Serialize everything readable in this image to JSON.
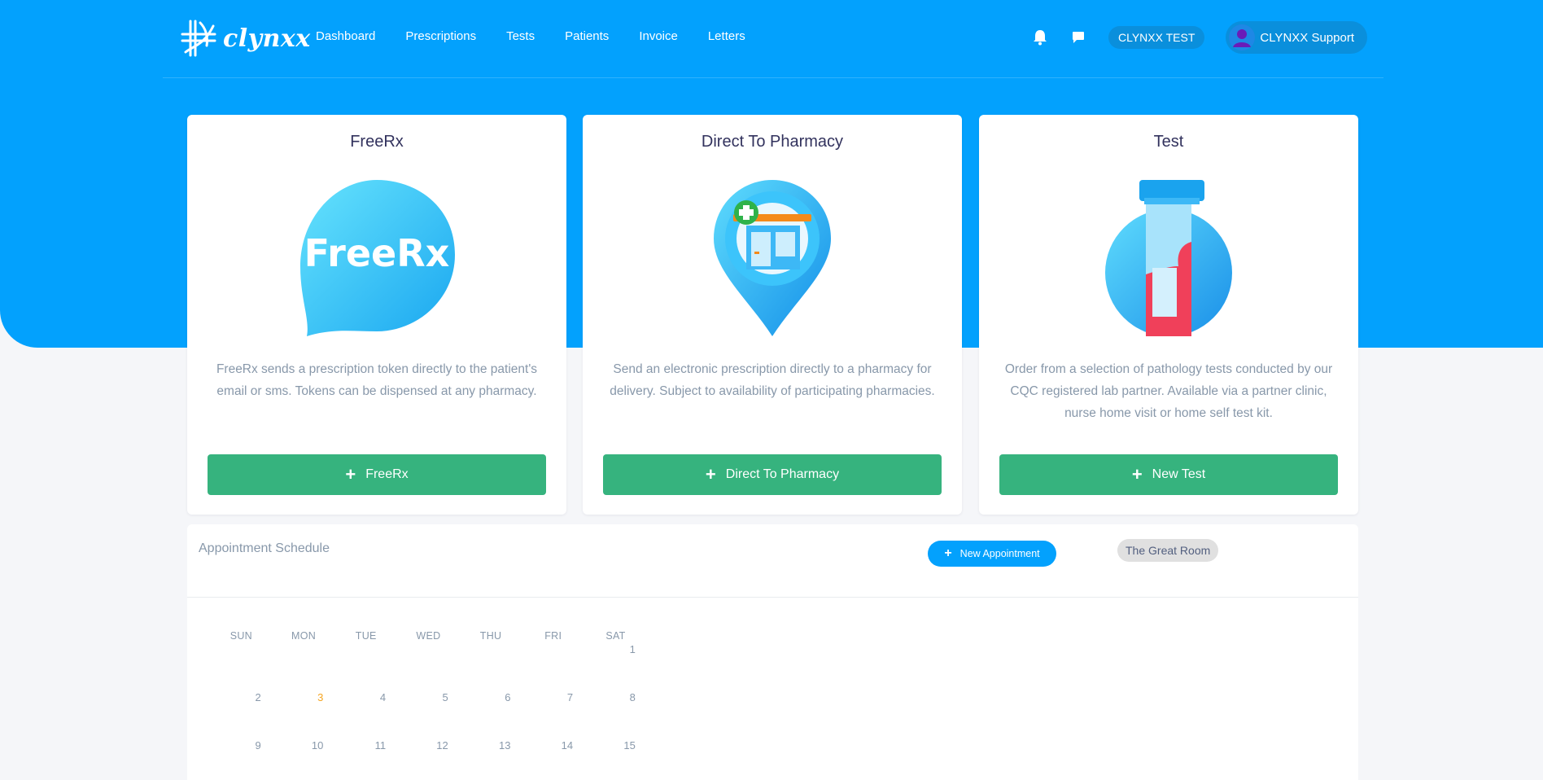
{
  "app": {
    "logo_text": "clynxx"
  },
  "nav": {
    "links": [
      "Dashboard",
      "Prescriptions",
      "Tests",
      "Patients",
      "Invoice",
      "Letters"
    ],
    "org": "CLYNXX TEST",
    "user": "CLYNXX Support"
  },
  "cards": [
    {
      "title": "FreeRx",
      "image_text": "FreeRx",
      "description": "FreeRx sends a prescription token directly to the patient's email or sms. Tokens can be dispensed at any pharmacy.",
      "button": "FreeRx"
    },
    {
      "title": "Direct To Pharmacy",
      "description": "Send an electronic prescription directly to a pharmacy for delivery. Subject to availability of participating pharmacies.",
      "button": "Direct To Pharmacy"
    },
    {
      "title": "Test",
      "description": "Order from a selection of pathology tests conducted by our CQC registered lab partner. Available via a partner clinic, nurse home visit or home self test kit.",
      "button": "New Test"
    }
  ],
  "schedule": {
    "title": "Appointment Schedule",
    "new_button": "New Appointment",
    "room": "The Great Room",
    "weekdays": [
      "SUN",
      "MON",
      "TUE",
      "WED",
      "THU",
      "FRI",
      "SAT"
    ],
    "weeks": [
      [
        "",
        "",
        "",
        "",
        "",
        "",
        "1"
      ],
      [
        "2",
        "3",
        "4",
        "5",
        "6",
        "7",
        "8"
      ],
      [
        "9",
        "10",
        "11",
        "12",
        "13",
        "14",
        "15"
      ]
    ],
    "today": "3"
  },
  "colors": {
    "primary": "#03a1fd",
    "success": "#36b37e",
    "today": "#f5a623"
  }
}
